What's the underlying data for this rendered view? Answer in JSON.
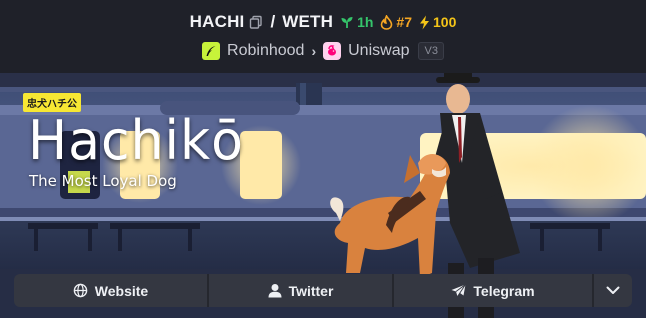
{
  "pair": {
    "base_symbol": "HACHI",
    "separator": "/",
    "quote_symbol": "WETH",
    "age": "1h",
    "rank": "#7",
    "boosts": "100"
  },
  "dex": {
    "chain": "Robinhood",
    "exchange": "Uniswap",
    "version": "V3"
  },
  "banner": {
    "kanji": "忠犬ハチ公",
    "title": "Hachikō",
    "subtitle": "The Most Loyal Dog"
  },
  "links": {
    "website": "Website",
    "twitter": "Twitter",
    "telegram": "Telegram"
  },
  "icons": {
    "copy": "copy-icon",
    "age": "seedling-icon",
    "rank": "flame-icon",
    "boost": "lightning-icon",
    "website": "globe-icon",
    "twitter": "user-icon",
    "telegram": "paper-plane-icon",
    "more": "chevron-down-icon"
  },
  "colors": {
    "background": "#1f2129",
    "age": "#35c46b",
    "rank": "#f5a623",
    "boost": "#f5c518",
    "chain": "#c7f33a",
    "kanji_badge": "#f7e733"
  }
}
